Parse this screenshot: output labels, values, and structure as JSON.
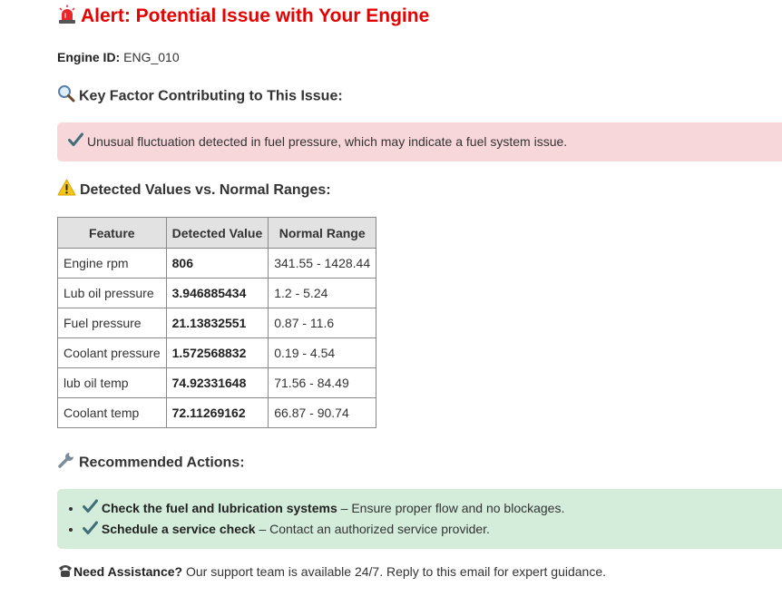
{
  "header": {
    "title_icon": "rotating-light-icon",
    "title": "Alert: Potential Issue with Your Engine"
  },
  "engine": {
    "label": "Engine ID:",
    "value": "ENG_010"
  },
  "key_factor": {
    "icon": "magnifier-icon",
    "heading": "Key Factor Contributing to This Issue:",
    "check_icon": "check-mark-icon",
    "message": "Unusual fluctuation detected in fuel pressure, which may indicate a fuel system issue."
  },
  "values_section": {
    "icon": "warning-icon",
    "heading": "Detected Values vs. Normal Ranges:"
  },
  "table": {
    "headers": [
      "Feature",
      "Detected Value",
      "Normal Range"
    ],
    "rows": [
      {
        "feature": "Engine rpm",
        "value": "806",
        "range": "341.55 - 1428.44"
      },
      {
        "feature": "Lub oil pressure",
        "value": "3.946885434",
        "range": "1.2 - 5.24"
      },
      {
        "feature": "Fuel pressure",
        "value": "21.13832551",
        "range": "0.87 - 11.6"
      },
      {
        "feature": "Coolant pressure",
        "value": "1.572568832",
        "range": "0.19 - 4.54"
      },
      {
        "feature": "lub oil temp",
        "value": "74.92331648",
        "range": "71.56 - 84.49"
      },
      {
        "feature": "Coolant temp",
        "value": "72.11269162",
        "range": "66.87 - 90.74"
      }
    ]
  },
  "actions": {
    "icon": "wrench-icon",
    "heading": "Recommended Actions:",
    "items": [
      {
        "title": "Check the fuel and lubrication systems",
        "desc": " – Ensure proper flow and no blockages."
      },
      {
        "title": "Schedule a service check",
        "desc": " – Contact an authorized service provider."
      }
    ]
  },
  "assistance": {
    "icon": "telephone-icon",
    "label": "Need Assistance?",
    "text": " Our support team is available 24/7. Reply to this email for expert guidance."
  },
  "colors": {
    "title": "#e60000",
    "alert_bg": "#f8d7da",
    "actions_bg": "#d4edda",
    "check": "#3a7d44"
  }
}
